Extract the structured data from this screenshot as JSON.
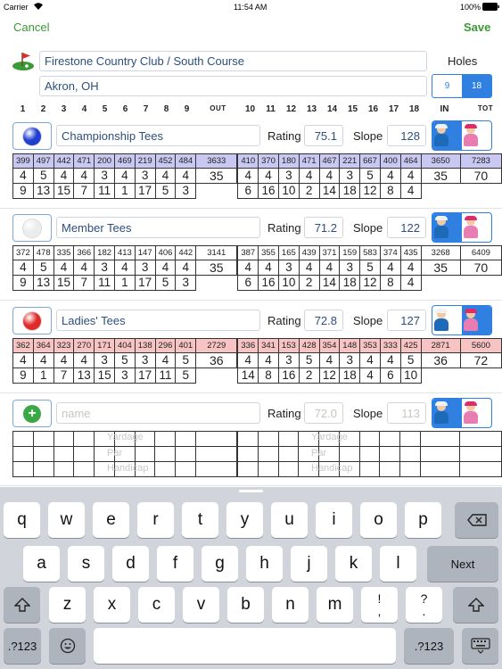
{
  "status_bar": {
    "carrier": "Carrier",
    "time": "11:54 AM",
    "battery": "100%"
  },
  "nav": {
    "cancel": "Cancel",
    "save": "Save"
  },
  "course": {
    "name": "Firestone Country Club / South Course",
    "location": "Akron, OH",
    "holes_label": "Holes",
    "holes_options": [
      "9",
      "18"
    ],
    "holes_selected": "18"
  },
  "hole_headers": [
    "1",
    "2",
    "3",
    "4",
    "5",
    "6",
    "7",
    "8",
    "9",
    "OUT",
    "10",
    "11",
    "12",
    "13",
    "14",
    "15",
    "16",
    "17",
    "18",
    "IN",
    "TOT"
  ],
  "labels": {
    "rating": "Rating",
    "slope": "Slope"
  },
  "tees": [
    {
      "name": "Championship Tees",
      "rating": "75.1",
      "slope": "128",
      "ball_color": "#1f3fd0",
      "band_color": "#c8c8f2",
      "selected": "male",
      "yardage": [
        "399",
        "497",
        "442",
        "471",
        "200",
        "469",
        "219",
        "452",
        "484",
        "3633",
        "410",
        "370",
        "180",
        "471",
        "467",
        "221",
        "667",
        "400",
        "464",
        "3650",
        "7283"
      ],
      "par": [
        "4",
        "5",
        "4",
        "4",
        "3",
        "4",
        "3",
        "4",
        "4",
        "35",
        "4",
        "4",
        "3",
        "4",
        "4",
        "3",
        "5",
        "4",
        "4",
        "35",
        "70"
      ],
      "handicap": [
        "9",
        "13",
        "15",
        "7",
        "11",
        "1",
        "17",
        "5",
        "3",
        "",
        "6",
        "16",
        "10",
        "2",
        "14",
        "18",
        "12",
        "8",
        "4",
        "",
        ""
      ]
    },
    {
      "name": "Member Tees",
      "rating": "71.2",
      "slope": "122",
      "ball_color": "#ececec",
      "band_color": "#ffffff",
      "selected": "male",
      "yardage": [
        "372",
        "478",
        "335",
        "366",
        "182",
        "413",
        "147",
        "406",
        "442",
        "3141",
        "387",
        "355",
        "165",
        "439",
        "371",
        "159",
        "583",
        "374",
        "435",
        "3268",
        "6409"
      ],
      "par": [
        "4",
        "5",
        "4",
        "4",
        "3",
        "4",
        "3",
        "4",
        "4",
        "35",
        "4",
        "4",
        "3",
        "4",
        "4",
        "3",
        "5",
        "4",
        "4",
        "35",
        "70"
      ],
      "handicap": [
        "9",
        "13",
        "15",
        "7",
        "11",
        "1",
        "17",
        "5",
        "3",
        "",
        "6",
        "16",
        "10",
        "2",
        "14",
        "18",
        "12",
        "8",
        "4",
        "",
        ""
      ]
    },
    {
      "name": "Ladies' Tees",
      "rating": "72.8",
      "slope": "127",
      "ball_color": "#e02b2b",
      "band_color": "#f7c3c3",
      "selected": "female",
      "yardage": [
        "362",
        "364",
        "323",
        "270",
        "171",
        "404",
        "138",
        "296",
        "401",
        "2729",
        "336",
        "341",
        "153",
        "428",
        "354",
        "148",
        "353",
        "333",
        "425",
        "2871",
        "5600"
      ],
      "par": [
        "4",
        "4",
        "4",
        "4",
        "3",
        "5",
        "3",
        "4",
        "5",
        "36",
        "4",
        "4",
        "3",
        "5",
        "4",
        "3",
        "4",
        "4",
        "5",
        "36",
        "72"
      ],
      "handicap": [
        "9",
        "1",
        "7",
        "13",
        "15",
        "3",
        "17",
        "11",
        "5",
        "",
        "14",
        "8",
        "16",
        "2",
        "12",
        "18",
        "4",
        "6",
        "10",
        "",
        ""
      ]
    }
  ],
  "new_tee": {
    "name_placeholder": "name",
    "rating_placeholder": "72.0",
    "slope_placeholder": "113",
    "row_labels": [
      "Yardage",
      "Par",
      "Handicap"
    ]
  },
  "keyboard": {
    "row1": [
      "q",
      "w",
      "e",
      "r",
      "t",
      "y",
      "u",
      "i",
      "o",
      "p"
    ],
    "row2": [
      "a",
      "s",
      "d",
      "f",
      "g",
      "h",
      "j",
      "k",
      "l"
    ],
    "row3": [
      "z",
      "x",
      "c",
      "v",
      "b",
      "n",
      "m",
      "!\n,",
      "?\n."
    ],
    "next": "Next",
    "numbers": ".?123",
    "icons": [
      "backspace-icon",
      "shift-icon",
      "emoji-icon",
      "keyboard-dismiss-icon"
    ]
  }
}
